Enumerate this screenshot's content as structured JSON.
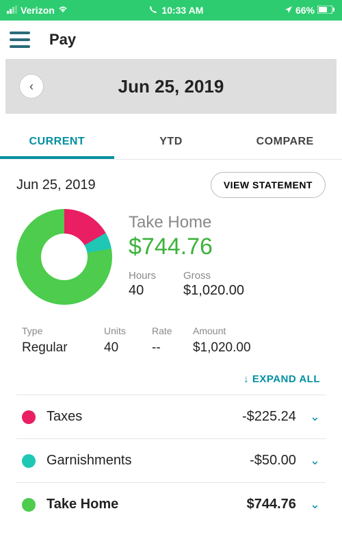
{
  "status": {
    "carrier": "Verizon",
    "time": "10:33 AM",
    "battery": "66%"
  },
  "header": {
    "title": "Pay"
  },
  "date_bar": {
    "date": "Jun 25, 2019"
  },
  "tabs": {
    "current": "CURRENT",
    "ytd": "YTD",
    "compare": "COMPARE"
  },
  "summary": {
    "date": "Jun 25, 2019",
    "view_statement": "VIEW STATEMENT",
    "take_home_label": "Take Home",
    "take_home_amount": "$744.76",
    "hours_label": "Hours",
    "hours_value": "40",
    "gross_label": "Gross",
    "gross_value": "$1,020.00"
  },
  "type_table": {
    "headers": {
      "type": "Type",
      "units": "Units",
      "rate": "Rate",
      "amount": "Amount"
    },
    "row": {
      "type": "Regular",
      "units": "40",
      "rate": "--",
      "amount": "$1,020.00"
    }
  },
  "expand_all": "EXPAND ALL",
  "breakdown": {
    "taxes": {
      "label": "Taxes",
      "amount": "-$225.24",
      "color": "#e91e63"
    },
    "garnishments": {
      "label": "Garnishments",
      "amount": "-$50.00",
      "color": "#1ec8b4"
    },
    "take_home": {
      "label": "Take Home",
      "amount": "$744.76",
      "color": "#4dcc4d"
    }
  },
  "chart_data": {
    "type": "pie",
    "series": [
      {
        "name": "Taxes",
        "value": 225.24,
        "color": "#e91e63"
      },
      {
        "name": "Garnishments",
        "value": 50.0,
        "color": "#1ec8b4"
      },
      {
        "name": "Take Home",
        "value": 744.76,
        "color": "#4dcc4d"
      }
    ],
    "total": 1020.0,
    "title": "Take Home"
  }
}
